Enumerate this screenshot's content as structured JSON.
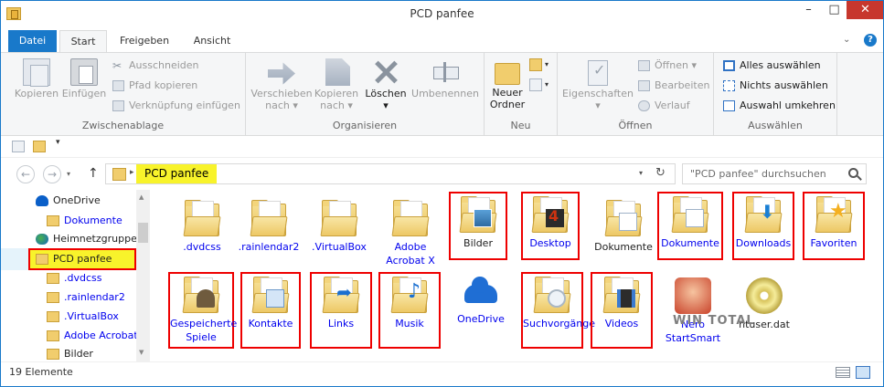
{
  "window": {
    "title": "PCD panfee",
    "minimize_glyph": "–",
    "maximize_glyph": "□",
    "close_glyph": "✕"
  },
  "tabs": {
    "file": "Datei",
    "start": "Start",
    "share": "Freigeben",
    "view": "Ansicht"
  },
  "ribbon": {
    "clipboard": {
      "label": "Zwischenablage",
      "copy": "Kopieren",
      "paste": "Einfügen",
      "cut": "Ausschneiden",
      "copy_path": "Pfad kopieren",
      "paste_shortcut": "Verknüpfung einfügen"
    },
    "organize": {
      "label": "Organisieren",
      "move_to_1": "Verschieben",
      "move_to_2": "nach",
      "copy_to_1": "Kopieren",
      "copy_to_2": "nach",
      "delete": "Löschen",
      "rename": "Umbenennen"
    },
    "new": {
      "label": "Neu",
      "new_folder_1": "Neuer",
      "new_folder_2": "Ordner"
    },
    "open": {
      "label": "Öffnen",
      "properties": "Eigenschaften",
      "open": "Öffnen",
      "edit": "Bearbeiten",
      "history": "Verlauf"
    },
    "select": {
      "label": "Auswählen",
      "select_all": "Alles auswählen",
      "select_none": "Nichts auswählen",
      "invert": "Auswahl umkehren"
    }
  },
  "address": {
    "path": "PCD panfee",
    "search_placeholder": "\"PCD panfee\" durchsuchen"
  },
  "sidebar": {
    "items": [
      {
        "label": "OneDrive",
        "icon": "cloud-icon",
        "blue": false
      },
      {
        "label": "Dokumente",
        "icon": "folder-icon",
        "blue": true
      },
      {
        "label": "Heimnetzgruppe",
        "icon": "homegroup-icon",
        "blue": false
      },
      {
        "label": "PCD panfee",
        "icon": "folder-icon",
        "blue": false
      },
      {
        "label": ".dvdcss",
        "icon": "folder-icon",
        "blue": true
      },
      {
        "label": ".rainlendar2",
        "icon": "folder-icon",
        "blue": true
      },
      {
        "label": ".VirtualBox",
        "icon": "folder-icon",
        "blue": true
      },
      {
        "label": "Adobe Acrobat",
        "icon": "folder-icon",
        "blue": true
      },
      {
        "label": "Bilder",
        "icon": "folder-icon",
        "blue": false
      }
    ]
  },
  "files": [
    {
      "name": ".dvdcss",
      "icon": "folder-icon"
    },
    {
      "name": ".rainlendar2",
      "icon": "folder-icon"
    },
    {
      "name": ".VirtualBox",
      "icon": "folder-icon"
    },
    {
      "name": "Adobe Acrobat X",
      "icon": "folder-icon"
    },
    {
      "name": "Bilder",
      "icon": "pictures-folder-icon"
    },
    {
      "name": "Desktop",
      "icon": "desktop-folder-icon"
    },
    {
      "name": "Dokumente",
      "icon": "documents-folder-icon"
    },
    {
      "name": "Dokumente",
      "icon": "documents-folder-icon"
    },
    {
      "name": "Downloads",
      "icon": "downloads-folder-icon"
    },
    {
      "name": "Favoriten",
      "icon": "favorites-folder-icon"
    },
    {
      "name": "Gespeicherte Spiele",
      "icon": "saved-games-folder-icon"
    },
    {
      "name": "Kontakte",
      "icon": "contacts-folder-icon"
    },
    {
      "name": "Links",
      "icon": "links-folder-icon"
    },
    {
      "name": "Musik",
      "icon": "music-folder-icon"
    },
    {
      "name": "OneDrive",
      "icon": "onedrive-icon"
    },
    {
      "name": "Suchvorgänge",
      "icon": "searches-folder-icon"
    },
    {
      "name": "Videos",
      "icon": "videos-folder-icon"
    },
    {
      "name": "Nero StartSmart",
      "icon": "nero-icon"
    },
    {
      "name": "ntuser.dat",
      "icon": "media-disc-icon"
    }
  ],
  "watermark": "WIN TOTAL",
  "status": {
    "count": "19 Elemente"
  },
  "colors": {
    "accent": "#1979ca",
    "highlight": "#f8f32b",
    "annotation": "#e00000",
    "link": "#0000ee"
  }
}
